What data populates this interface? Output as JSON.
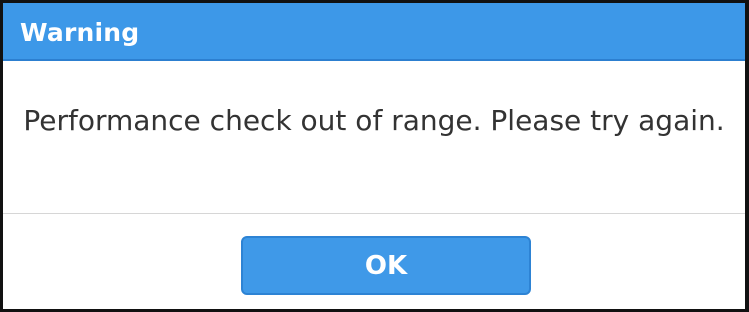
{
  "dialog": {
    "title": "Warning",
    "message": "Performance check out of range. Please try again.",
    "ok_label": "OK"
  },
  "colors": {
    "titlebar": "#3d98e8",
    "button": "#3f99e8",
    "message_text": "#333333"
  }
}
